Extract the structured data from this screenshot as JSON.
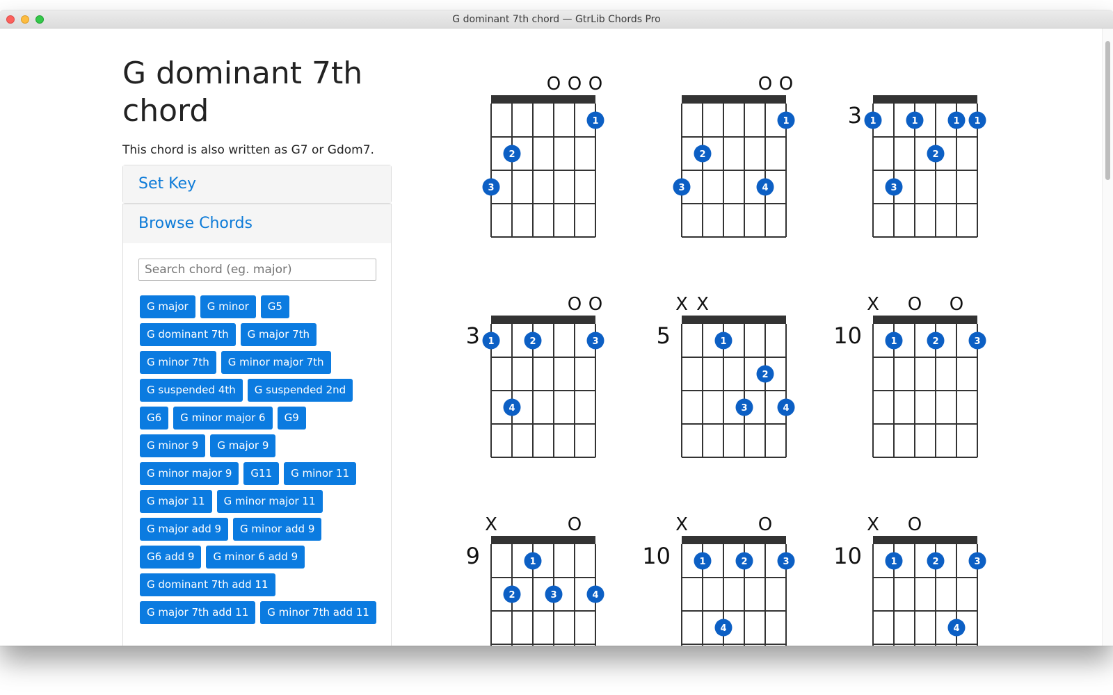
{
  "window": {
    "title": "G dominant 7th chord — GtrLib Chords Pro"
  },
  "page": {
    "title": "G dominant 7th chord",
    "alias_text": "This chord is also written as G7 or Gdom7."
  },
  "panels": {
    "set_key_label": "Set Key",
    "browse_label": "Browse Chords",
    "search_placeholder": "Search chord (eg. major)"
  },
  "chords": [
    "G major",
    "G minor",
    "G5",
    "G dominant 7th",
    "G major 7th",
    "G minor 7th",
    "G minor major 7th",
    "G suspended 4th",
    "G suspended 2nd",
    "G6",
    "G minor major 6",
    "G9",
    "G minor 9",
    "G major 9",
    "G minor major 9",
    "G11",
    "G minor 11",
    "G major 11",
    "G minor major 11",
    "G major add 9",
    "G minor add 9",
    "G6 add 9",
    "G minor 6 add 9",
    "G dominant 7th add 11",
    "G major 7th add 11",
    "G minor 7th add 11"
  ],
  "colors": {
    "accent": "#0b7be0",
    "finger_dot": "#0c5fc4",
    "grid": "#333333"
  },
  "diagrams": [
    {
      "base_fret": null,
      "marks": [
        "",
        "",
        "",
        "O",
        "O",
        "O"
      ],
      "fingers": [
        {
          "string": 1,
          "fret": 3,
          "label": "3"
        },
        {
          "string": 2,
          "fret": 2,
          "label": "2"
        },
        {
          "string": 6,
          "fret": 1,
          "label": "1"
        }
      ]
    },
    {
      "base_fret": null,
      "marks": [
        "",
        "",
        "",
        "",
        "O",
        "O"
      ],
      "fingers": [
        {
          "string": 1,
          "fret": 3,
          "label": "3"
        },
        {
          "string": 2,
          "fret": 2,
          "label": "2"
        },
        {
          "string": 5,
          "fret": 3,
          "label": "4"
        },
        {
          "string": 6,
          "fret": 1,
          "label": "1"
        }
      ]
    },
    {
      "base_fret": "3",
      "marks": [
        "",
        "",
        "",
        "",
        "",
        ""
      ],
      "fingers": [
        {
          "string": 1,
          "fret": 1,
          "label": "1"
        },
        {
          "string": 2,
          "fret": 3,
          "label": "3"
        },
        {
          "string": 3,
          "fret": 1,
          "label": "1"
        },
        {
          "string": 4,
          "fret": 2,
          "label": "2"
        },
        {
          "string": 5,
          "fret": 1,
          "label": "1"
        },
        {
          "string": 6,
          "fret": 1,
          "label": "1"
        }
      ]
    },
    {
      "base_fret": "3",
      "marks": [
        "",
        "",
        "",
        "",
        "O",
        "O"
      ],
      "fingers": [
        {
          "string": 1,
          "fret": 1,
          "label": "1"
        },
        {
          "string": 2,
          "fret": 3,
          "label": "4"
        },
        {
          "string": 3,
          "fret": 1,
          "label": "2"
        },
        {
          "string": 6,
          "fret": 1,
          "label": "3"
        }
      ]
    },
    {
      "base_fret": "5",
      "marks": [
        "X",
        "X",
        "",
        "",
        "",
        ""
      ],
      "fingers": [
        {
          "string": 3,
          "fret": 1,
          "label": "1"
        },
        {
          "string": 4,
          "fret": 3,
          "label": "3"
        },
        {
          "string": 5,
          "fret": 2,
          "label": "2"
        },
        {
          "string": 6,
          "fret": 3,
          "label": "4"
        }
      ]
    },
    {
      "base_fret": "10",
      "marks": [
        "X",
        "",
        "O",
        "",
        "O",
        ""
      ],
      "fingers": [
        {
          "string": 2,
          "fret": 1,
          "label": "1"
        },
        {
          "string": 4,
          "fret": 1,
          "label": "2"
        },
        {
          "string": 6,
          "fret": 1,
          "label": "3"
        }
      ]
    },
    {
      "base_fret": "9",
      "marks": [
        "X",
        "",
        "",
        "",
        "O",
        ""
      ],
      "fingers": [
        {
          "string": 2,
          "fret": 2,
          "label": "2"
        },
        {
          "string": 3,
          "fret": 1,
          "label": "1"
        },
        {
          "string": 4,
          "fret": 2,
          "label": "3"
        },
        {
          "string": 6,
          "fret": 2,
          "label": "4"
        }
      ]
    },
    {
      "base_fret": "10",
      "marks": [
        "X",
        "",
        "",
        "",
        "O",
        ""
      ],
      "fingers": [
        {
          "string": 2,
          "fret": 1,
          "label": "1"
        },
        {
          "string": 3,
          "fret": 3,
          "label": "4"
        },
        {
          "string": 4,
          "fret": 1,
          "label": "2"
        },
        {
          "string": 6,
          "fret": 1,
          "label": "3"
        }
      ]
    },
    {
      "base_fret": "10",
      "marks": [
        "X",
        "",
        "O",
        "",
        "",
        ""
      ],
      "fingers": [
        {
          "string": 2,
          "fret": 1,
          "label": "1"
        },
        {
          "string": 4,
          "fret": 1,
          "label": "2"
        },
        {
          "string": 5,
          "fret": 3,
          "label": "4"
        },
        {
          "string": 6,
          "fret": 1,
          "label": "3"
        }
      ]
    }
  ]
}
